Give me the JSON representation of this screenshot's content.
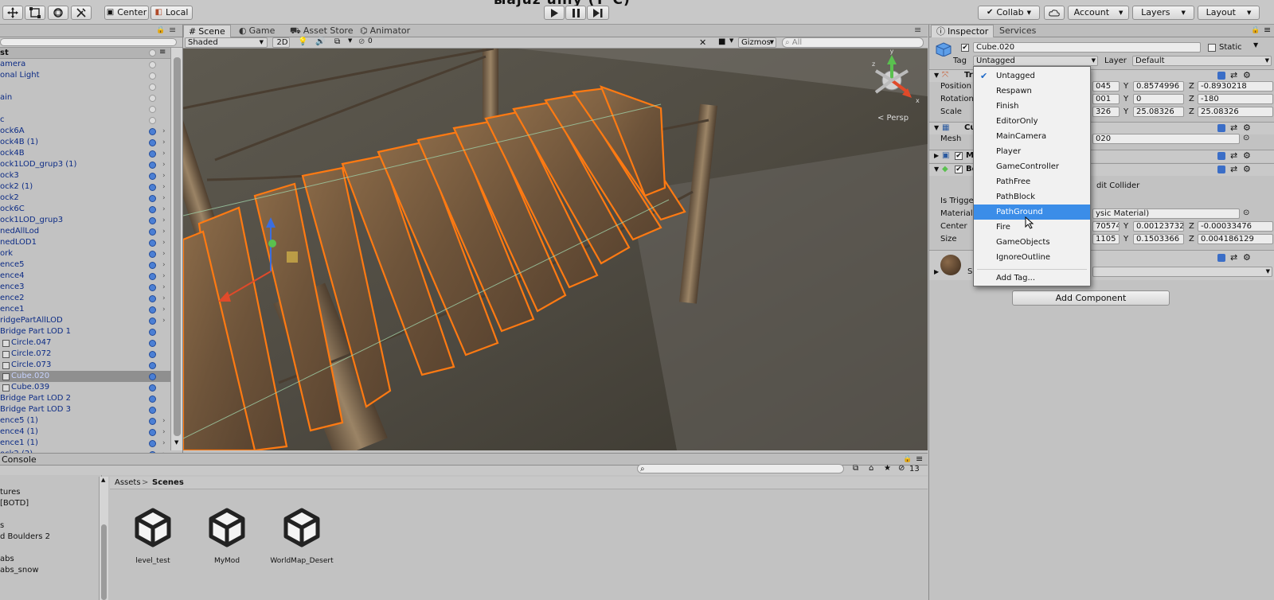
{
  "title_fragment": "ыаjuz uniy (T°C)",
  "toolbar": {
    "pivot": "Center",
    "pivot_icon": "center-icon",
    "space": "Local",
    "space_icon": "globe-icon",
    "collab": "Collab",
    "account": "Account",
    "layers": "Layers",
    "layout": "Layout"
  },
  "hierarchy": {
    "header": "st",
    "rows": [
      {
        "label": "amera",
        "eye": "off",
        "arrow": false,
        "indent": false,
        "selected": false
      },
      {
        "label": "onal Light",
        "eye": "off",
        "arrow": false,
        "indent": false,
        "selected": false
      },
      {
        "label": "",
        "eye": "off",
        "arrow": false,
        "indent": false,
        "selected": false
      },
      {
        "label": "ain",
        "eye": "off",
        "arrow": false,
        "indent": false,
        "selected": false
      },
      {
        "label": "",
        "eye": "off",
        "arrow": false,
        "indent": false,
        "selected": false
      },
      {
        "label": "c",
        "eye": "off",
        "arrow": false,
        "indent": false,
        "selected": false
      },
      {
        "label": "ock6A",
        "eye": "on",
        "arrow": true,
        "indent": false,
        "selected": false
      },
      {
        "label": "ock4B (1)",
        "eye": "on",
        "arrow": true,
        "indent": false,
        "selected": false
      },
      {
        "label": "ock4B",
        "eye": "on",
        "arrow": true,
        "indent": false,
        "selected": false
      },
      {
        "label": "ock1LOD_grup3 (1)",
        "eye": "on",
        "arrow": true,
        "indent": false,
        "selected": false
      },
      {
        "label": "ock3",
        "eye": "on",
        "arrow": true,
        "indent": false,
        "selected": false
      },
      {
        "label": "ock2 (1)",
        "eye": "on",
        "arrow": true,
        "indent": false,
        "selected": false
      },
      {
        "label": "ock2",
        "eye": "on",
        "arrow": true,
        "indent": false,
        "selected": false
      },
      {
        "label": "ock6C",
        "eye": "on",
        "arrow": true,
        "indent": false,
        "selected": false
      },
      {
        "label": "ock1LOD_grup3",
        "eye": "on",
        "arrow": true,
        "indent": false,
        "selected": false
      },
      {
        "label": "nedAllLod",
        "eye": "on",
        "arrow": true,
        "indent": false,
        "selected": false
      },
      {
        "label": "nedLOD1",
        "eye": "on",
        "arrow": true,
        "indent": false,
        "selected": false
      },
      {
        "label": "ork",
        "eye": "on",
        "arrow": true,
        "indent": false,
        "selected": false
      },
      {
        "label": "ence5",
        "eye": "on",
        "arrow": true,
        "indent": false,
        "selected": false
      },
      {
        "label": "ence4",
        "eye": "on",
        "arrow": true,
        "indent": false,
        "selected": false
      },
      {
        "label": "ence3",
        "eye": "on",
        "arrow": true,
        "indent": false,
        "selected": false
      },
      {
        "label": "ence2",
        "eye": "on",
        "arrow": true,
        "indent": false,
        "selected": false
      },
      {
        "label": "ence1",
        "eye": "on",
        "arrow": true,
        "indent": false,
        "selected": false
      },
      {
        "label": "ridgePartAllLOD",
        "eye": "on",
        "arrow": true,
        "indent": false,
        "selected": false
      },
      {
        "label": "Bridge Part LOD 1",
        "eye": "on",
        "arrow": false,
        "indent": false,
        "selected": false
      },
      {
        "label": "Circle.047",
        "eye": "on",
        "arrow": false,
        "indent": true,
        "selected": false
      },
      {
        "label": "Circle.072",
        "eye": "on",
        "arrow": false,
        "indent": true,
        "selected": false
      },
      {
        "label": "Circle.073",
        "eye": "on",
        "arrow": false,
        "indent": true,
        "selected": false
      },
      {
        "label": "Cube.020",
        "eye": "on",
        "arrow": false,
        "indent": true,
        "selected": true
      },
      {
        "label": "Cube.039",
        "eye": "on",
        "arrow": false,
        "indent": true,
        "selected": false
      },
      {
        "label": "Bridge Part LOD 2",
        "eye": "on",
        "arrow": false,
        "indent": false,
        "selected": false
      },
      {
        "label": "Bridge Part LOD 3",
        "eye": "on",
        "arrow": false,
        "indent": false,
        "selected": false
      },
      {
        "label": "ence5 (1)",
        "eye": "on",
        "arrow": true,
        "indent": false,
        "selected": false
      },
      {
        "label": "ence4 (1)",
        "eye": "on",
        "arrow": true,
        "indent": false,
        "selected": false
      },
      {
        "label": "ence1 (1)",
        "eye": "on",
        "arrow": true,
        "indent": false,
        "selected": false
      },
      {
        "label": "ock2 (2)",
        "eye": "on",
        "arrow": true,
        "indent": false,
        "selected": false
      }
    ]
  },
  "scene": {
    "tabs": [
      {
        "label": "Scene",
        "icon": "hash-icon",
        "active": true
      },
      {
        "label": "Game",
        "icon": "pacman-icon",
        "active": false
      },
      {
        "label": "Asset Store",
        "icon": "store-icon",
        "active": false
      },
      {
        "label": "Animator",
        "icon": "animator-icon",
        "active": false
      }
    ],
    "shading": "Shaded",
    "mode_2d": "2D",
    "fx_count": "0",
    "gizmos": "Gizmos",
    "search_placeholder": "All",
    "persp": "< Persp",
    "gizmo_axes": {
      "x": "x",
      "y": "y",
      "z": "z"
    }
  },
  "inspector": {
    "tabs": [
      {
        "label": "Inspector",
        "active": true
      },
      {
        "label": "Services",
        "active": false
      }
    ],
    "object_name": "Cube.020",
    "static_label": "Static",
    "tag_label": "Tag",
    "tag_value": "Untagged",
    "layer_label": "Layer",
    "layer_value": "Default",
    "transform_title": "Tr",
    "position_label": "Position",
    "position": {
      "x": "045",
      "y": "0.8574996",
      "z": "-0.8930218"
    },
    "rotation_label": "Rotation",
    "rotation": {
      "x": "001",
      "y": "0",
      "z": "-180"
    },
    "scale_label": "Scale",
    "scale": {
      "x": "326",
      "y": "25.08326",
      "z": "25.08326"
    },
    "mesh_filter_title": "Cu",
    "mesh_label": "Mesh",
    "mesh_value": "020",
    "renderer_title": "M",
    "collider_title": "Bo",
    "edit_collider": "dit Collider",
    "is_trigger_label": "Is Trigge",
    "material_label": "Material",
    "material_value": "ysic Material)",
    "center_label": "Center",
    "center": {
      "x": "70574",
      "y": "0.001237325",
      "z": "-0.00033476"
    },
    "size_label": "Size",
    "size": {
      "x": "1105",
      "y": "0.1503366",
      "z": "0.004186129"
    },
    "material_comp_title": "W",
    "shader_label": "S",
    "add_component": "Add Component",
    "axis_labels": {
      "x": "X",
      "y": "Y",
      "z": "Z"
    }
  },
  "tag_dropdown": {
    "items": [
      "Untagged",
      "Respawn",
      "Finish",
      "EditorOnly",
      "MainCamera",
      "Player",
      "GameController",
      "PathFree",
      "PathBlock",
      "PathGround",
      "Fire",
      "GameObjects",
      "IgnoreOutline"
    ],
    "checked": "Untagged",
    "highlighted": "PathGround",
    "add_tag": "Add Tag..."
  },
  "console": {
    "tab": "Console"
  },
  "project": {
    "breadcrumb_root": "Assets",
    "breadcrumb_sep": ">",
    "breadcrumb_current": "Scenes",
    "count": "13",
    "tree": [
      "tures",
      "[BOTD]",
      "",
      "s",
      "d Boulders 2",
      "",
      "abs",
      "abs_snow"
    ],
    "assets": [
      "level_test",
      "MyMod",
      "WorldMap_Desert"
    ]
  },
  "colors": {
    "selection_orange": "#ff7a12",
    "highlight_blue": "#3b8de8",
    "hierarchy_text": "#0c2b85"
  }
}
